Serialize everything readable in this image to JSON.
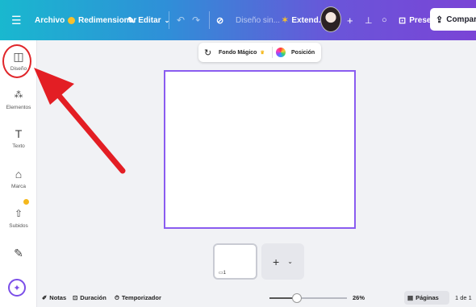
{
  "topbar": {
    "menu_icon": "hamburger-icon",
    "archivo": "Archivo",
    "redimensionar": "Redimensionar",
    "editar": "Editar",
    "doc_title": "Diseño sin...",
    "extend": "Extend...",
    "presentar": "Presentar",
    "compartir": "Compartir",
    "colors": {
      "start": "#19b8cf",
      "end": "#7a44d6",
      "crown": "#f7c02c"
    }
  },
  "sidebar": {
    "items": [
      {
        "label": "Diseño",
        "icon": "layout-icon"
      },
      {
        "label": "Elementos",
        "icon": "shapes-icon"
      },
      {
        "label": "Texto",
        "icon": "text-icon"
      },
      {
        "label": "Marca",
        "icon": "brand-icon"
      },
      {
        "label": "Subidos",
        "icon": "upload-icon"
      },
      {
        "label": "",
        "icon": "draw-icon"
      }
    ],
    "accent": "#e0262a"
  },
  "float_toolbar": {
    "fondo_magico": "Fondo Mágico",
    "posicion": "Posición"
  },
  "pages": {
    "page_number": "1"
  },
  "bottombar": {
    "notas": "Notas",
    "duracion": "Duración",
    "temporizador": "Temporizador",
    "zoom": "26%",
    "zoom_fraction": 0.26,
    "paginas": "Páginas",
    "page_count": "1 de 1"
  }
}
